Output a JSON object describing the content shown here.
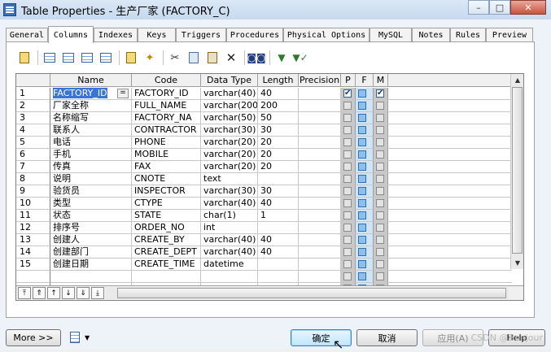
{
  "window": {
    "title": "Table Properties - 生产厂家 (FACTORY_C)",
    "controls": [
      "–",
      "□",
      "✕"
    ]
  },
  "tabs": [
    "General",
    "Columns",
    "Indexes",
    "Keys",
    "Triggers",
    "Procedures",
    "Physical Options",
    "MySQL",
    "Notes",
    "Rules",
    "Preview"
  ],
  "active_tab": "Columns",
  "toolbar": [
    "properties-icon",
    "insert-row-icon",
    "add-row-icon",
    "insert-cols-icon",
    "add-cols-icon",
    "new-icon",
    "paste-new-icon",
    "cut-icon",
    "copy-icon",
    "paste-icon",
    "delete-icon",
    "find-icon",
    "filter-icon",
    "filter-clear-icon"
  ],
  "grid": {
    "headers": [
      "Name",
      "Code",
      "Data Type",
      "Length",
      "Precision",
      "P",
      "F",
      "M"
    ],
    "rows": [
      {
        "n": "1",
        "name": "FACTORY_ID",
        "code": "FACTORY_ID",
        "type": "varchar(40)",
        "length": "40",
        "precision": "",
        "p": true,
        "f": false,
        "m": true
      },
      {
        "n": "2",
        "name": "厂家全称",
        "code": "FULL_NAME",
        "type": "varchar(200)",
        "length": "200",
        "precision": "",
        "p": false,
        "f": false,
        "m": false
      },
      {
        "n": "3",
        "name": "名称缩写",
        "code": "FACTORY_NA",
        "type": "varchar(50)",
        "length": "50",
        "precision": "",
        "p": false,
        "f": false,
        "m": false
      },
      {
        "n": "4",
        "name": "联系人",
        "code": "CONTRACTOR",
        "type": "varchar(30)",
        "length": "30",
        "precision": "",
        "p": false,
        "f": false,
        "m": false
      },
      {
        "n": "5",
        "name": "电话",
        "code": "PHONE",
        "type": "varchar(20)",
        "length": "20",
        "precision": "",
        "p": false,
        "f": false,
        "m": false
      },
      {
        "n": "6",
        "name": "手机",
        "code": "MOBILE",
        "type": "varchar(20)",
        "length": "20",
        "precision": "",
        "p": false,
        "f": false,
        "m": false
      },
      {
        "n": "7",
        "name": "传真",
        "code": "FAX",
        "type": "varchar(20)",
        "length": "20",
        "precision": "",
        "p": false,
        "f": false,
        "m": false
      },
      {
        "n": "8",
        "name": "说明",
        "code": "CNOTE",
        "type": "text",
        "length": "",
        "precision": "",
        "p": false,
        "f": false,
        "m": false
      },
      {
        "n": "9",
        "name": "验货员",
        "code": "INSPECTOR",
        "type": "varchar(30)",
        "length": "30",
        "precision": "",
        "p": false,
        "f": false,
        "m": false
      },
      {
        "n": "10",
        "name": "类型",
        "code": "CTYPE",
        "type": "varchar(40)",
        "length": "40",
        "precision": "",
        "p": false,
        "f": false,
        "m": false
      },
      {
        "n": "11",
        "name": "状态",
        "code": "STATE",
        "type": "char(1)",
        "length": "1",
        "precision": "",
        "p": false,
        "f": false,
        "m": false
      },
      {
        "n": "12",
        "name": "排序号",
        "code": "ORDER_NO",
        "type": "int",
        "length": "",
        "precision": "",
        "p": false,
        "f": false,
        "m": false
      },
      {
        "n": "13",
        "name": "创建人",
        "code": "CREATE_BY",
        "type": "varchar(40)",
        "length": "40",
        "precision": "",
        "p": false,
        "f": false,
        "m": false
      },
      {
        "n": "14",
        "name": "创建部门",
        "code": "CREATE_DEPT",
        "type": "varchar(40)",
        "length": "40",
        "precision": "",
        "p": false,
        "f": false,
        "m": false
      },
      {
        "n": "15",
        "name": "创建日期",
        "code": "CREATE_TIME",
        "type": "datetime",
        "length": "",
        "precision": "",
        "p": false,
        "f": false,
        "m": false
      }
    ],
    "empty_rows": 2,
    "row1_edit_button": "="
  },
  "buttons": {
    "more": "More >>",
    "ok": "确定",
    "cancel": "取消",
    "apply": "应用(A)",
    "help": "Help"
  },
  "watermark": "CSDN @Bonjour"
}
